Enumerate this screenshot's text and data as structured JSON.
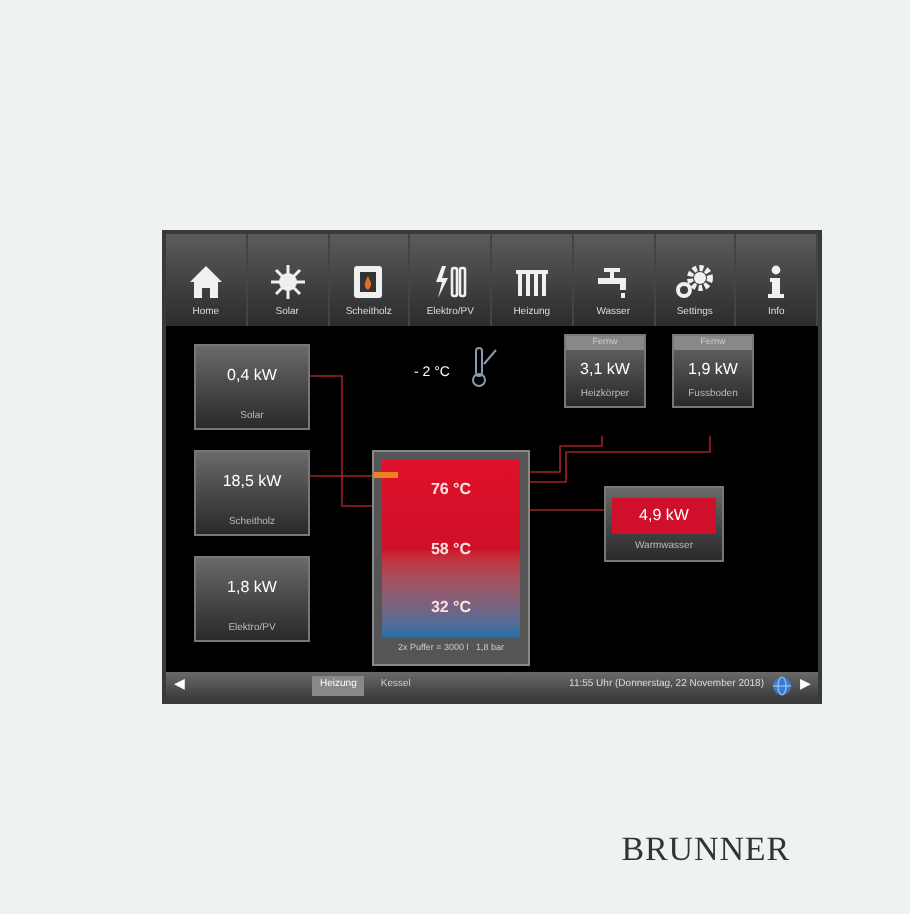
{
  "nav": [
    {
      "label": "Home"
    },
    {
      "label": "Solar"
    },
    {
      "label": "Scheitholz"
    },
    {
      "label": "Elektro/PV"
    },
    {
      "label": "Heizung"
    },
    {
      "label": "Wasser"
    },
    {
      "label": "Settings"
    },
    {
      "label": "Info"
    }
  ],
  "sources": [
    {
      "value": "0,4 kW",
      "label": "Solar"
    },
    {
      "value": "18,5 kW",
      "label": "Scheitholz"
    },
    {
      "value": "1,8 kW",
      "label": "Elektro/PV"
    }
  ],
  "outdoor": {
    "temperature": "- 2 °C"
  },
  "tank": {
    "temps": [
      {
        "value": "76 °C"
      },
      {
        "value": "58 °C"
      },
      {
        "value": "32 °C"
      }
    ],
    "caption": "2x Puffer = 3000 l   1,8 bar"
  },
  "consumers": [
    {
      "kind": "circuit",
      "header": "Fernw",
      "value": "3,1 kW",
      "label": "Heizkörper"
    },
    {
      "kind": "circuit",
      "header": "Fernw",
      "value": "1,9 kW",
      "label": "Fussboden"
    },
    {
      "kind": "hot",
      "value": "4,9 kW",
      "label": "Warmwasser"
    }
  ],
  "status_bar": {
    "back": "◀",
    "tabs": [
      {
        "label": "Heizung",
        "selected": true
      },
      {
        "label": "Kessel",
        "selected": false
      }
    ],
    "datetime": "11:55 Uhr (Donnerstag, 22 November 2018)",
    "forward": "▶"
  },
  "brand": "BRUNNER"
}
